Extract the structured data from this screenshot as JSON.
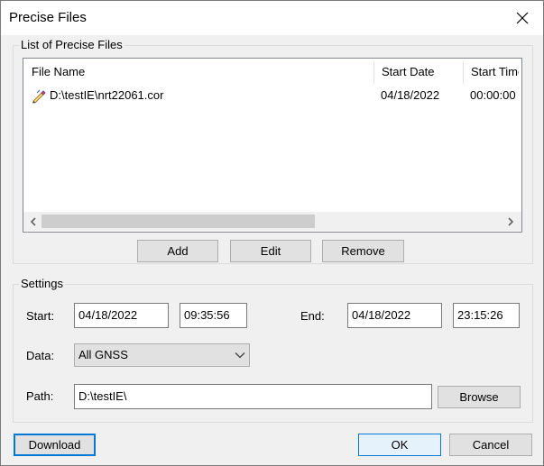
{
  "window": {
    "title": "Precise Files"
  },
  "list_group": {
    "label": "List of Precise Files",
    "columns": [
      "File Name",
      "Start Date",
      "Start Time"
    ],
    "rows": [
      {
        "file_name": "D:\\testIE\\nrt22061.cor",
        "start_date": "04/18/2022",
        "start_time": "00:00:00"
      }
    ],
    "icons": {
      "file": "pen-file-icon",
      "scroll_left": "chevron-left-icon",
      "scroll_right": "chevron-right-icon"
    }
  },
  "list_buttons": {
    "add": "Add",
    "edit": "Edit",
    "remove": "Remove"
  },
  "settings": {
    "label": "Settings",
    "start_label": "Start:",
    "start_date": "04/18/2022",
    "start_time": "09:35:56",
    "end_label": "End:",
    "end_date": "04/18/2022",
    "end_time": "23:15:26",
    "data_label": "Data:",
    "data_value": "All GNSS",
    "path_label": "Path:",
    "path_value": "D:\\testIE\\",
    "browse": "Browse"
  },
  "footer": {
    "download": "Download",
    "ok": "OK",
    "cancel": "Cancel"
  },
  "colors": {
    "accent": "#0078d7",
    "face": "#f0f0f0",
    "button": "#e1e1e1"
  }
}
